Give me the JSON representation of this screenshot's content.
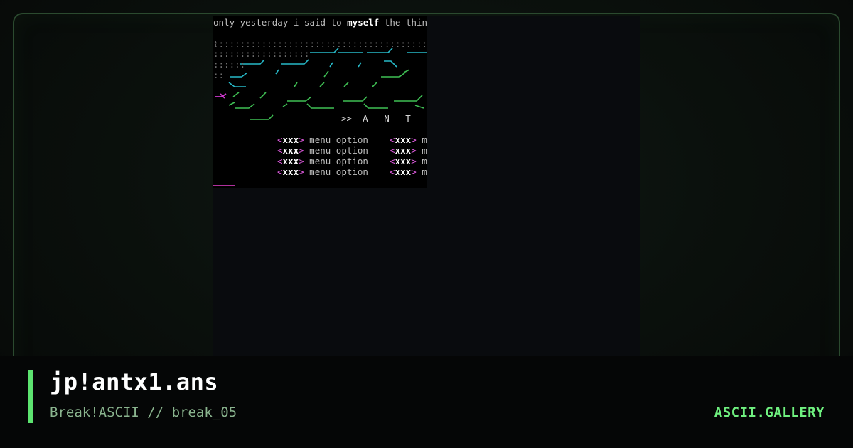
{
  "artwork": {
    "top_line": {
      "before": "only yesterday i said to ",
      "emphasis": "myself",
      "after": " the thin"
    },
    "tagline": ">>  A   N   T",
    "menu_items": [
      {
        "key": "xxx",
        "label": "menu option",
        "key2": "xxx",
        "label2": "m"
      },
      {
        "key": "xxx",
        "label": "menu option",
        "key2": "xxx",
        "label2": "m"
      },
      {
        "key": "xxx",
        "label": "menu option",
        "key2": "xxx",
        "label2": "m"
      },
      {
        "key": "xxx",
        "label": "menu option",
        "key2": "xxx",
        "label2": "m"
      }
    ]
  },
  "footer": {
    "title": "jp!antx1.ans",
    "subtitle": "Break!ASCII // break_05",
    "brand": "ASCII.GALLERY"
  },
  "colors": {
    "accent": "#5ce36f",
    "brand": "#6ff07f",
    "frame_border": "#2b4a2f",
    "ansi_cyan": "#27b9c8",
    "ansi_green": "#3fbf54",
    "ansi_magenta": "#d13ad1"
  }
}
